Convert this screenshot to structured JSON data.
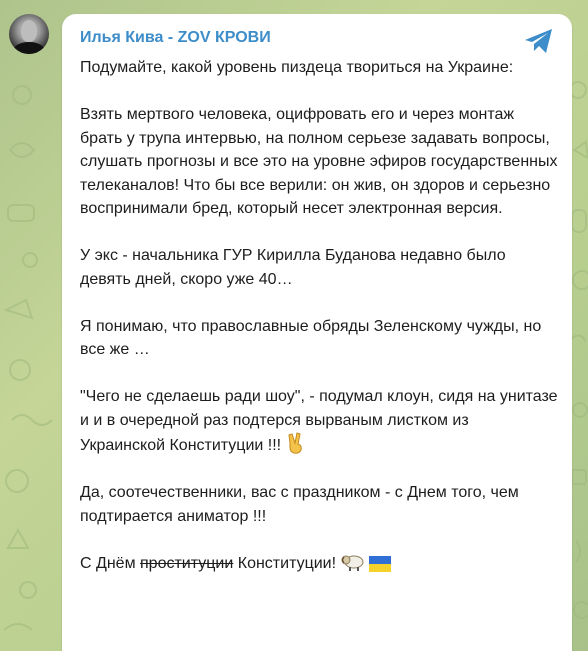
{
  "channel": {
    "name": "Илья Кива - ZOV КРОВИ"
  },
  "icons": {
    "avatar": "avatar",
    "share": "telegram-send-icon",
    "victory": "victory-hand-icon",
    "ram": "ram-icon",
    "flag": "ukraine-flag-icon"
  },
  "colors": {
    "accent": "#3c8dc9",
    "bubble": "#ffffff",
    "text": "#1d1d1d"
  },
  "message": {
    "p1": "Подумайте, какой уровень пиздеца твориться на Украине:",
    "p2": "Взять мертвого человека, оцифровать его и через монтаж брать у трупа интервью, на полном серьезе задавать вопросы, слушать прогнозы и все это на уровне эфиров государственных телеканалов! Что бы все верили: он жив, он здоров и серьезно воспринимали бред, который несет электронная версия.",
    "p3": "У экс - начальника ГУР Кирилла Буданова недавно было девять дней, скоро уже 40…",
    "p4": "Я понимаю, что православные обряды Зеленскому чужды, но все же …",
    "p5": "\"Чего не сделаешь ради шоу\", - подумал клоун, сидя на унитазе и и в очередной раз подтерся вырваным листком из Украинской Конституции !!!",
    "p6": "Да, соотечественники, вас с праздником - с Днем того, чем подтирается аниматор !!!",
    "p7_prefix": "С Днём ",
    "p7_strike": "проституции",
    "p7_suffix": " Конституции! "
  }
}
